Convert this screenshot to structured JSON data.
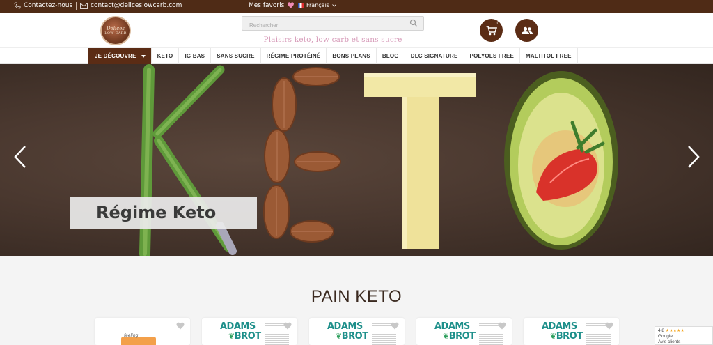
{
  "topbar": {
    "contact_label": "Contactez-nous",
    "email": "contact@deliceslowcarb.com",
    "favorites_label": "Mes favoris",
    "language": "Français"
  },
  "header": {
    "logo_line1": "Délices",
    "logo_line2": "LOW CARB",
    "search_placeholder": "Rechercher",
    "tagline": "Plaisirs keto, low carb et sans sucre",
    "cart_count": "0"
  },
  "nav": {
    "items": [
      {
        "label": "JE DÉCOUVRE"
      },
      {
        "label": "KETO"
      },
      {
        "label": "IG BAS"
      },
      {
        "label": "SANS SUCRE"
      },
      {
        "label": "RÉGIME PROTÉINÉ"
      },
      {
        "label": "BONS PLANS"
      },
      {
        "label": "BLOG"
      },
      {
        "label": "DLC SIGNATURE"
      },
      {
        "label": "POLYOLS FREE"
      },
      {
        "label": "MALTITOL FREE"
      }
    ]
  },
  "hero": {
    "caption": "Régime Keto"
  },
  "section": {
    "title": "PAIN KETO"
  },
  "cards": [
    {
      "pack_label": "feeling"
    },
    {
      "brand_line1": "ADAMS",
      "brand_line2": "BROT"
    },
    {
      "brand_line1": "ADAMS",
      "brand_line2": "BROT"
    },
    {
      "brand_line1": "ADAMS",
      "brand_line2": "BROT"
    },
    {
      "brand_line1": "ADAMS",
      "brand_line2": "BROT"
    }
  ],
  "rating": {
    "score": "4,8",
    "stars": "★★★★★",
    "source": "Google",
    "label": "Avis clients"
  },
  "colors": {
    "brand_brown": "#5b2c15",
    "topbar_brown": "#4f2b16",
    "tagline_pink": "#d79bb9",
    "brand_teal": "#1d8f8a"
  }
}
